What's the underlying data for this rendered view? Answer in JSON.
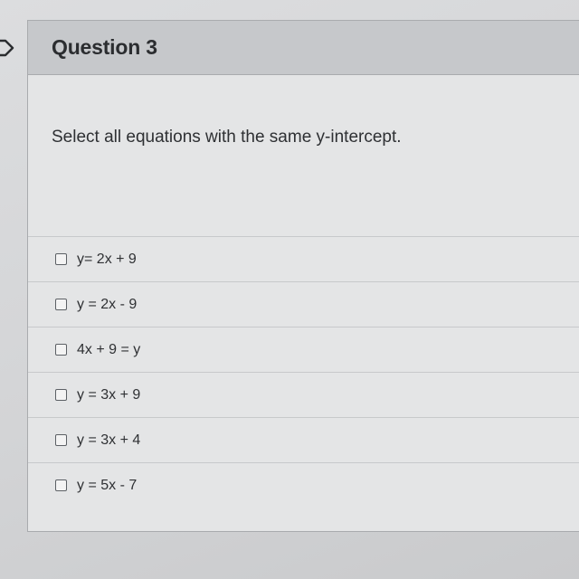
{
  "question": {
    "title": "Question 3",
    "prompt": "Select all equations with the same y-intercept."
  },
  "answers": [
    {
      "label": "y= 2x + 9",
      "checked": false
    },
    {
      "label": "y = 2x - 9",
      "checked": false
    },
    {
      "label": "4x + 9 = y",
      "checked": false
    },
    {
      "label": "y = 3x + 9",
      "checked": false
    },
    {
      "label": "y = 3x + 4",
      "checked": false
    },
    {
      "label": "y = 5x - 7",
      "checked": false
    }
  ],
  "icons": {
    "flag": "flag-icon"
  },
  "colors": {
    "header_bg": "#c6c8cb",
    "card_bg": "#e4e5e6",
    "text": "#2e3033"
  }
}
